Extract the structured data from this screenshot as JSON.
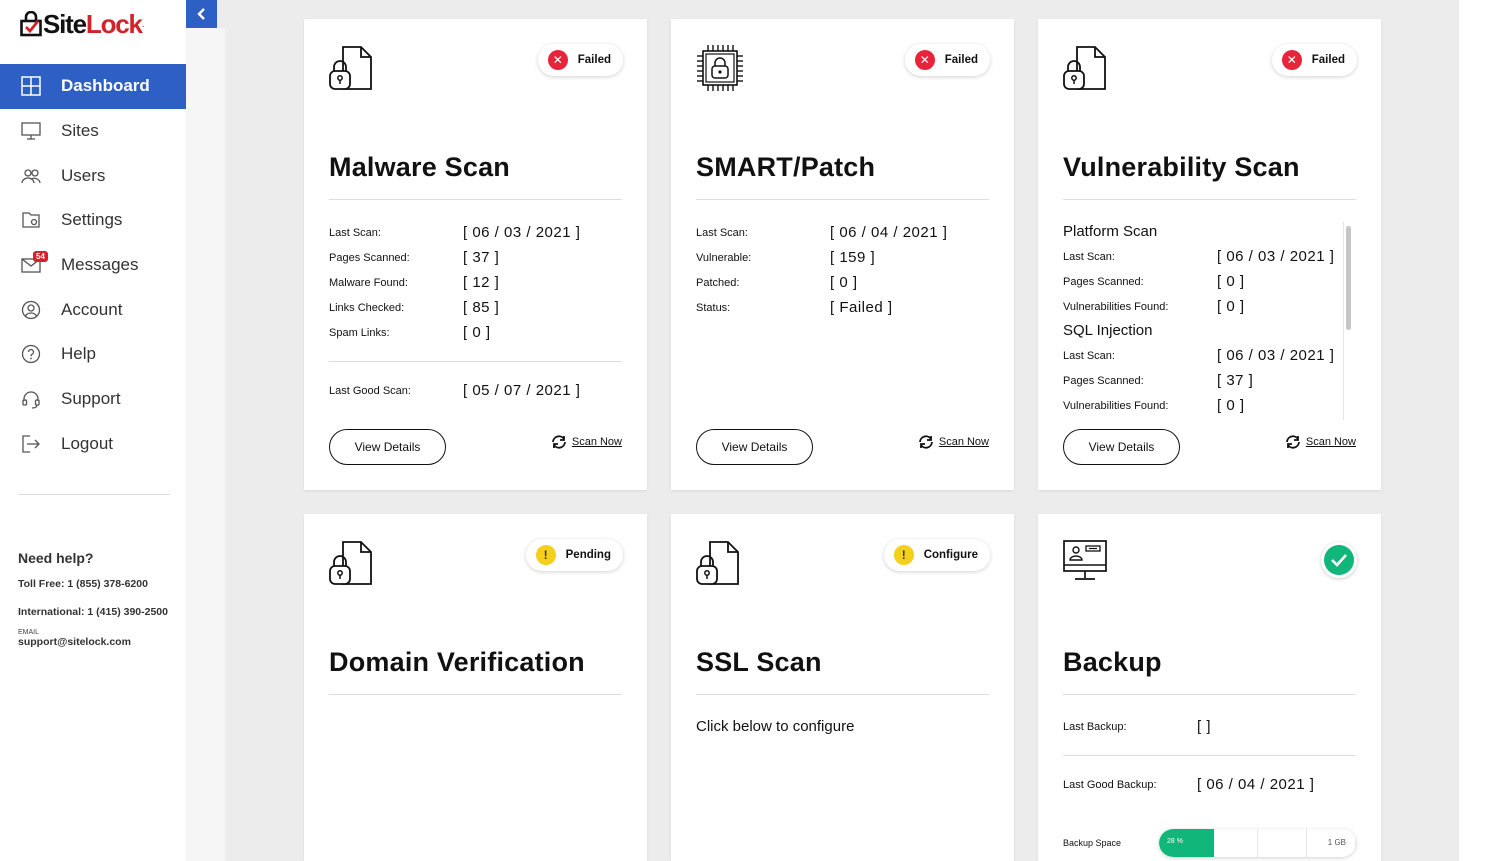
{
  "brand": {
    "site": "Site",
    "lock": "Lock"
  },
  "sidebar": {
    "items": [
      {
        "label": "Dashboard",
        "icon": "grid-icon",
        "active": true
      },
      {
        "label": "Sites",
        "icon": "monitor-icon"
      },
      {
        "label": "Users",
        "icon": "users-icon"
      },
      {
        "label": "Settings",
        "icon": "settings-icon"
      },
      {
        "label": "Messages",
        "icon": "mail-icon",
        "badge": "54"
      },
      {
        "label": "Account",
        "icon": "account-icon"
      },
      {
        "label": "Help",
        "icon": "help-icon"
      },
      {
        "label": "Support",
        "icon": "headset-icon"
      },
      {
        "label": "Logout",
        "icon": "logout-icon"
      }
    ],
    "help": {
      "title": "Need help?",
      "toll_free": "Toll Free: 1 (855) 378-6200",
      "international": "International: 1 (415) 390-2500",
      "email_label": "EMAIL",
      "email": "support@sitelock.com"
    }
  },
  "cards": {
    "malware": {
      "status": "Failed",
      "title": "Malware Scan",
      "rows": [
        {
          "k": "Last Scan:",
          "v": "[ 06 / 03 / 2021 ]"
        },
        {
          "k": "Pages Scanned:",
          "v": "[ 37 ]"
        },
        {
          "k": "Malware Found:",
          "v": "[ 12 ]"
        },
        {
          "k": "Links Checked:",
          "v": "[ 85 ]"
        },
        {
          "k": "Spam Links:",
          "v": "[ 0 ]"
        }
      ],
      "last_good": {
        "k": "Last Good Scan:",
        "v": "[ 05 / 07 / 2021 ]"
      },
      "view_details": "View Details",
      "scan_now": "Scan Now"
    },
    "smart": {
      "status": "Failed",
      "title": "SMART/Patch",
      "rows": [
        {
          "k": "Last Scan:",
          "v": "[ 06 / 04 / 2021 ]"
        },
        {
          "k": "Vulnerable:",
          "v": "[ 159 ]"
        },
        {
          "k": "Patched:",
          "v": "[ 0 ]"
        },
        {
          "k": "Status:",
          "v": "[ Failed ]"
        }
      ],
      "view_details": "View Details",
      "scan_now": "Scan Now"
    },
    "vuln": {
      "status": "Failed",
      "title": "Vulnerability Scan",
      "platform_label": "Platform Scan",
      "platform_rows": [
        {
          "k": "Last Scan:",
          "v": "[ 06 / 03 / 2021 ]"
        },
        {
          "k": "Pages Scanned:",
          "v": "[ 0 ]"
        },
        {
          "k": "Vulnerabilities Found:",
          "v": "[ 0 ]"
        }
      ],
      "sql_label": "SQL Injection",
      "sql_rows": [
        {
          "k": "Last Scan:",
          "v": "[ 06 / 03 / 2021 ]"
        },
        {
          "k": "Pages Scanned:",
          "v": "[ 37 ]"
        },
        {
          "k": "Vulnerabilities Found:",
          "v": "[ 0 ]"
        }
      ],
      "view_details": "View Details",
      "scan_now": "Scan Now"
    },
    "domain": {
      "status": "Pending",
      "title": "Domain Verification"
    },
    "ssl": {
      "status": "Configure",
      "title": "SSL Scan",
      "text": "Click below to configure"
    },
    "backup": {
      "title": "Backup",
      "last_backup": {
        "k": "Last Backup:",
        "v": "[ ]"
      },
      "last_good": {
        "k": "Last Good Backup:",
        "v": "[ 06 / 04 / 2021 ]"
      },
      "space_label": "Backup Space",
      "space_used": "28 %",
      "space_fraction": 0.28,
      "space_max": "1 GB"
    }
  },
  "colors": {
    "accent": "#2d5fc4",
    "failed": "#e8243a",
    "pending": "#f4cf1b",
    "success": "#10b67a",
    "brand_red": "#d2232a"
  }
}
